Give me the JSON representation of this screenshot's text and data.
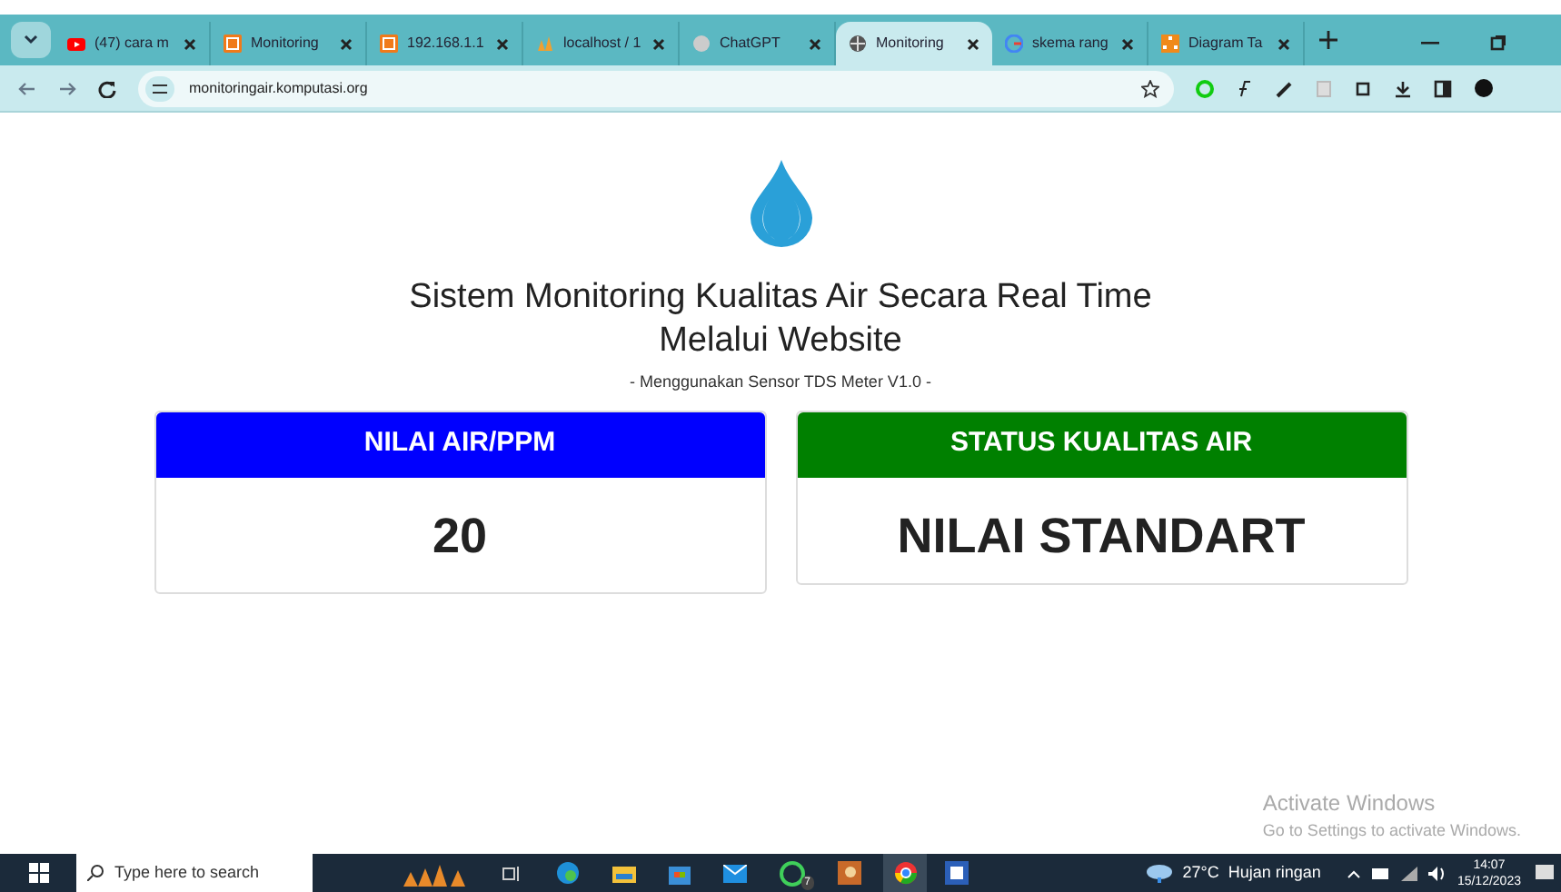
{
  "browser": {
    "tabs": [
      {
        "title": "(47) cara m",
        "kind": "video",
        "selected": false
      },
      {
        "title": "Monitoring",
        "kind": "server",
        "selected": false
      },
      {
        "title": "192.168.1.1",
        "kind": "server",
        "selected": false
      },
      {
        "title": "localhost / 1",
        "kind": "sails",
        "selected": false
      },
      {
        "title": "ChatGPT",
        "kind": "circle",
        "selected": false
      },
      {
        "title": "Monitoring",
        "kind": "globe",
        "selected": true
      },
      {
        "title": "skema rang",
        "kind": "search",
        "selected": false
      },
      {
        "title": "Diagram Ta",
        "kind": "diagram",
        "selected": false
      }
    ],
    "address": "monitoringair.komputasi.org"
  },
  "page": {
    "title": "Sistem Monitoring Kualitas Air Secara Real Time Melalui Website",
    "subtitle": "- Menggunakan Sensor TDS Meter V1.0 -",
    "cards": [
      {
        "header": "NILAI AIR/PPM",
        "value": "20",
        "color": "#0000ff"
      },
      {
        "header": "STATUS KUALITAS AIR",
        "value": "NILAI STANDART",
        "color": "#008000"
      }
    ]
  },
  "watermark": {
    "title": "Activate Windows",
    "text": "Go to Settings to activate Windows."
  },
  "taskbar": {
    "search_placeholder": "Type here to search",
    "whatsapp_badge": "7",
    "weather": "27°C  Hujan ringan",
    "time": "14:07",
    "date": "15/12/2023"
  }
}
